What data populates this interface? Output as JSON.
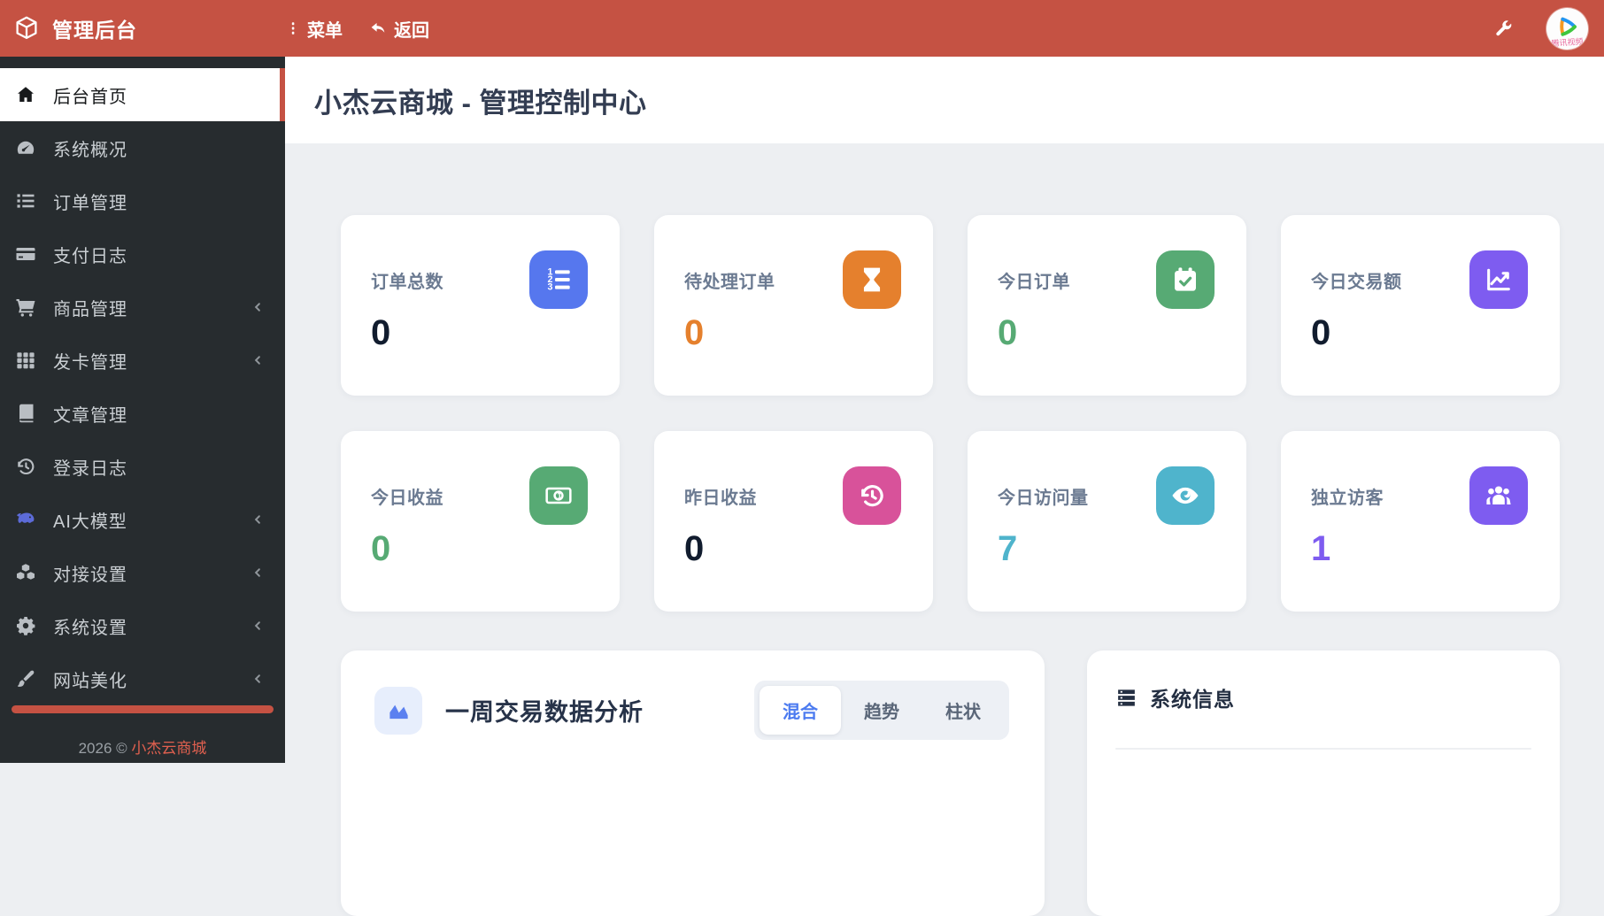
{
  "topbar": {
    "brand": "管理后台",
    "menu_label": "菜单",
    "back_label": "返回",
    "bar_color": "#c55243"
  },
  "sidebar": {
    "items": [
      {
        "label": "后台首页",
        "icon": "home-icon",
        "active": true
      },
      {
        "label": "系统概况",
        "icon": "dashboard-icon"
      },
      {
        "label": "订单管理",
        "icon": "list-icon"
      },
      {
        "label": "支付日志",
        "icon": "credit-card-icon"
      },
      {
        "label": "商品管理",
        "icon": "cart-icon",
        "expandable": true
      },
      {
        "label": "发卡管理",
        "icon": "grid-icon",
        "expandable": true
      },
      {
        "label": "文章管理",
        "icon": "book-icon"
      },
      {
        "label": "登录日志",
        "icon": "history-icon"
      },
      {
        "label": "AI大模型",
        "icon": "whale-icon",
        "expandable": true
      },
      {
        "label": "对接设置",
        "icon": "cubes-icon",
        "expandable": true
      },
      {
        "label": "系统设置",
        "icon": "gear-icon",
        "expandable": true
      },
      {
        "label": "网站美化",
        "icon": "brush-icon",
        "expandable": true
      }
    ],
    "footer_year": "2026 ©",
    "footer_brand": "小杰云商城",
    "scrollbar_color": "#c55243"
  },
  "page": {
    "title": "小杰云商城 - 管理控制中心"
  },
  "stats": [
    {
      "label": "订单总数",
      "value": "0",
      "icon": "list-ol-icon",
      "accent": "#5677ee",
      "value_color": "#111c2e"
    },
    {
      "label": "待处理订单",
      "value": "0",
      "icon": "hourglass-icon",
      "accent": "#e5802d",
      "value_color": "#e5802d"
    },
    {
      "label": "今日订单",
      "value": "0",
      "icon": "calendar-check-icon",
      "accent": "#57aa74",
      "value_color": "#57aa74"
    },
    {
      "label": "今日交易额",
      "value": "0",
      "icon": "chart-line-icon",
      "accent": "#7e5cf0",
      "value_color": "#111c2e"
    },
    {
      "label": "今日收益",
      "value": "0",
      "icon": "money-bill-icon",
      "accent": "#57aa74",
      "value_color": "#57aa74"
    },
    {
      "label": "昨日收益",
      "value": "0",
      "icon": "history-icon",
      "accent": "#d8529a",
      "value_color": "#111c2e"
    },
    {
      "label": "今日访问量",
      "value": "7",
      "icon": "eye-icon",
      "accent": "#4fb4cc",
      "value_color": "#4fb4cc"
    },
    {
      "label": "独立访客",
      "value": "1",
      "icon": "users-icon",
      "accent": "#7e5cf0",
      "value_color": "#7e5cf0"
    }
  ],
  "chart_panel": {
    "title": "一周交易数据分析",
    "icon": "area-chart-icon",
    "tabs": [
      {
        "label": "混合",
        "active": true
      },
      {
        "label": "趋势",
        "active": false
      },
      {
        "label": "柱状",
        "active": false
      }
    ]
  },
  "system_panel": {
    "title": "系统信息",
    "icon": "server-icon"
  }
}
